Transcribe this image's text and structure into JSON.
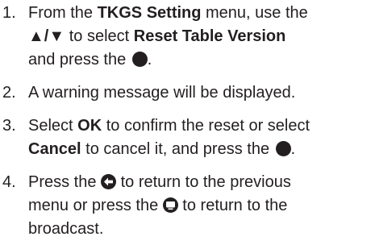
{
  "steps": [
    {
      "num": "1.",
      "t1": "From the ",
      "b1": "TKGS Setting",
      "t2": " menu, use the",
      "arrows": "▲/▼",
      "t3": " to select ",
      "b2": "Reset Table Version",
      "t4": "and press the "
    },
    {
      "num": "2.",
      "text": "A warning message will be displayed."
    },
    {
      "num": "3.",
      "t1": "Select ",
      "b1": "OK",
      "t2": " to confirm the reset or select",
      "b2": "Cancel",
      "t3": " to cancel it, and press the "
    },
    {
      "num": "4.",
      "t1": "Press the ",
      "t2": " to return to the previous",
      "t3": "menu or press the ",
      "t4": " to return to the",
      "t5": "broadcast."
    }
  ],
  "icons": {
    "ok": "ok-button-icon",
    "back": "back-button-icon",
    "exit": "exit-button-icon"
  },
  "colors": {
    "text": "#231f20"
  }
}
